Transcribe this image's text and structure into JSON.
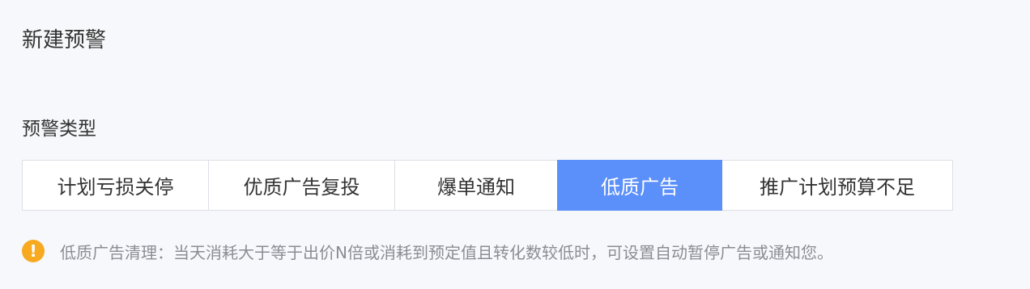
{
  "page_title": "新建预警",
  "alert_type": {
    "label": "预警类型",
    "options": [
      {
        "label": "计划亏损关停",
        "selected": false
      },
      {
        "label": "优质广告复投",
        "selected": false
      },
      {
        "label": "爆单通知",
        "selected": false
      },
      {
        "label": "低质广告",
        "selected": true
      },
      {
        "label": "推广计划预算不足",
        "selected": false
      }
    ]
  },
  "hint": {
    "icon": "warning-circle-icon",
    "icon_glyph": "!",
    "text": "低质广告清理：当天消耗大于等于出价N倍或消耗到预定值且转化数较低时，可设置自动暂停广告或通知您。"
  },
  "colors": {
    "accent": "#5b8ff9",
    "warning": "#f7a91f"
  }
}
